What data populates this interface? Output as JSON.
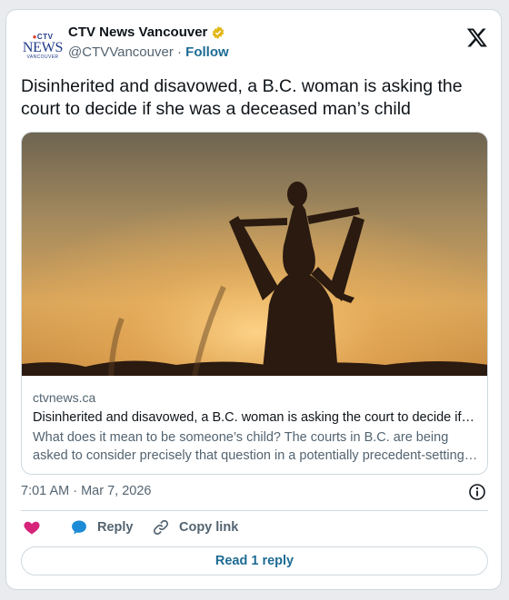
{
  "account": {
    "logo_ctv": "CTV",
    "logo_news": "NEWS",
    "logo_city": "VANCOUVER",
    "display_name": "CTV News Vancouver",
    "handle": "@CTVVancouver",
    "separator": "·",
    "follow_label": "Follow"
  },
  "tweet": {
    "text": "Disinherited and disavowed, a B.C. woman is asking the court to decide if she was a deceased man’s child"
  },
  "link_card": {
    "domain": "ctvnews.ca",
    "title": "Disinherited and disavowed, a B.C. woman is asking the court to decide if she was a deceased man’s child",
    "description": "What does it mean to be someone’s child? The courts in B.C. are being asked to consider precisely that question in a potentially precedent-setting case."
  },
  "meta": {
    "timestamp": "7:01 AM · Mar 7, 2026"
  },
  "actions": {
    "reply_label": "Reply",
    "copy_link_label": "Copy link",
    "read_replies_label": "Read 1 reply"
  },
  "colors": {
    "link_blue": "#1d6b94",
    "like_pink": "#d6247a",
    "muted": "#536471",
    "verified_gold": "#e2b719"
  }
}
